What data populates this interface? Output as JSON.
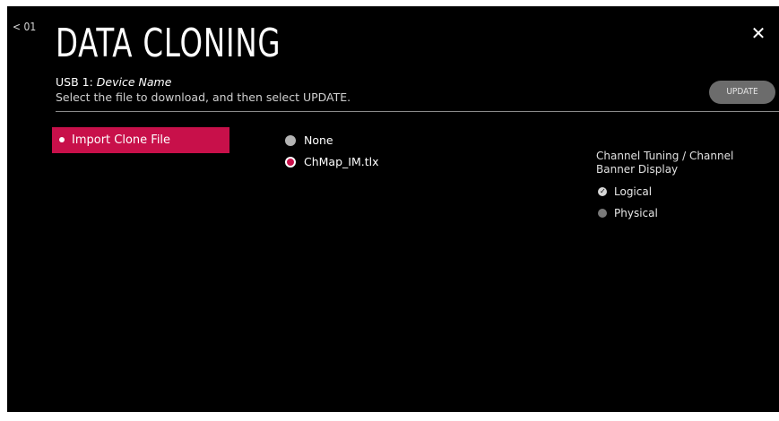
{
  "header": {
    "back_label": "< 01",
    "title": "DATA CLONING",
    "usb_prefix": "USB 1: ",
    "device_name": "Device Name",
    "instruction": "Select the file to download, and then select UPDATE.",
    "update_label": "UPDATE",
    "close_icon": "close-icon",
    "close_glyph": "✕"
  },
  "menu": {
    "items": [
      {
        "label": "Import Clone File",
        "selected": true
      }
    ]
  },
  "files": {
    "options": [
      {
        "label": "None",
        "selected": false
      },
      {
        "label": "ChMap_IM.tlx",
        "selected": true
      }
    ]
  },
  "channel_tuning": {
    "title": "Channel Tuning / Channel Banner Display",
    "options": [
      {
        "label": "Logical",
        "selected": true
      },
      {
        "label": "Physical",
        "selected": false
      }
    ]
  },
  "colors": {
    "background": "#000000",
    "accent": "#c8104a",
    "update_button": "#6c6c6c",
    "divider": "#8a8a8a"
  }
}
